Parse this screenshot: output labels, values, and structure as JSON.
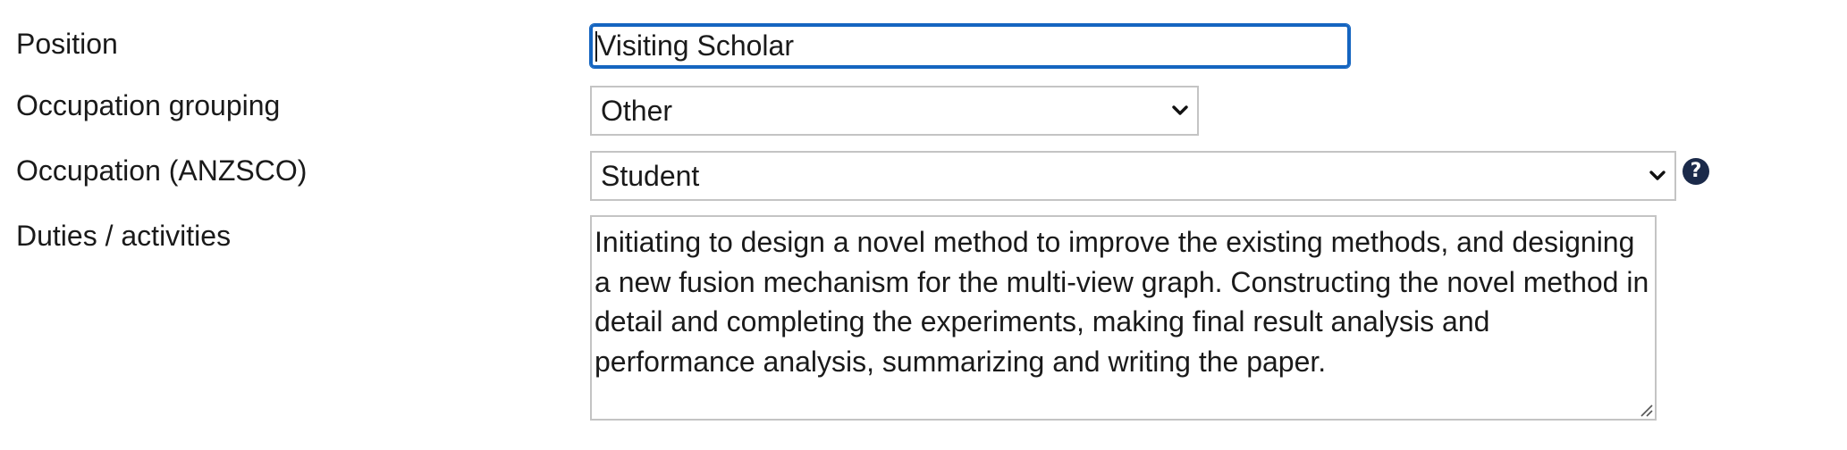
{
  "form": {
    "position": {
      "label": "Position",
      "value": "Visiting Scholar"
    },
    "occupation_grouping": {
      "label": "Occupation grouping",
      "selected": "Other"
    },
    "occupation_anzsco": {
      "label": "Occupation (ANZSCO)",
      "selected": "Student",
      "help_icon": "question-circle-icon"
    },
    "duties": {
      "label": "Duties / activities",
      "value": "Initiating to design a novel method to improve the existing methods, and designing a new fusion mechanism for the multi-view graph.  Constructing the novel method in detail and completing the experiments, making final result analysis and performance analysis, summarizing and writing the paper."
    }
  },
  "colors": {
    "focus_border": "#1565c0",
    "field_border": "#c4c4c4",
    "help_icon_bg": "#1b2a4a",
    "text": "#1a1a1a"
  }
}
